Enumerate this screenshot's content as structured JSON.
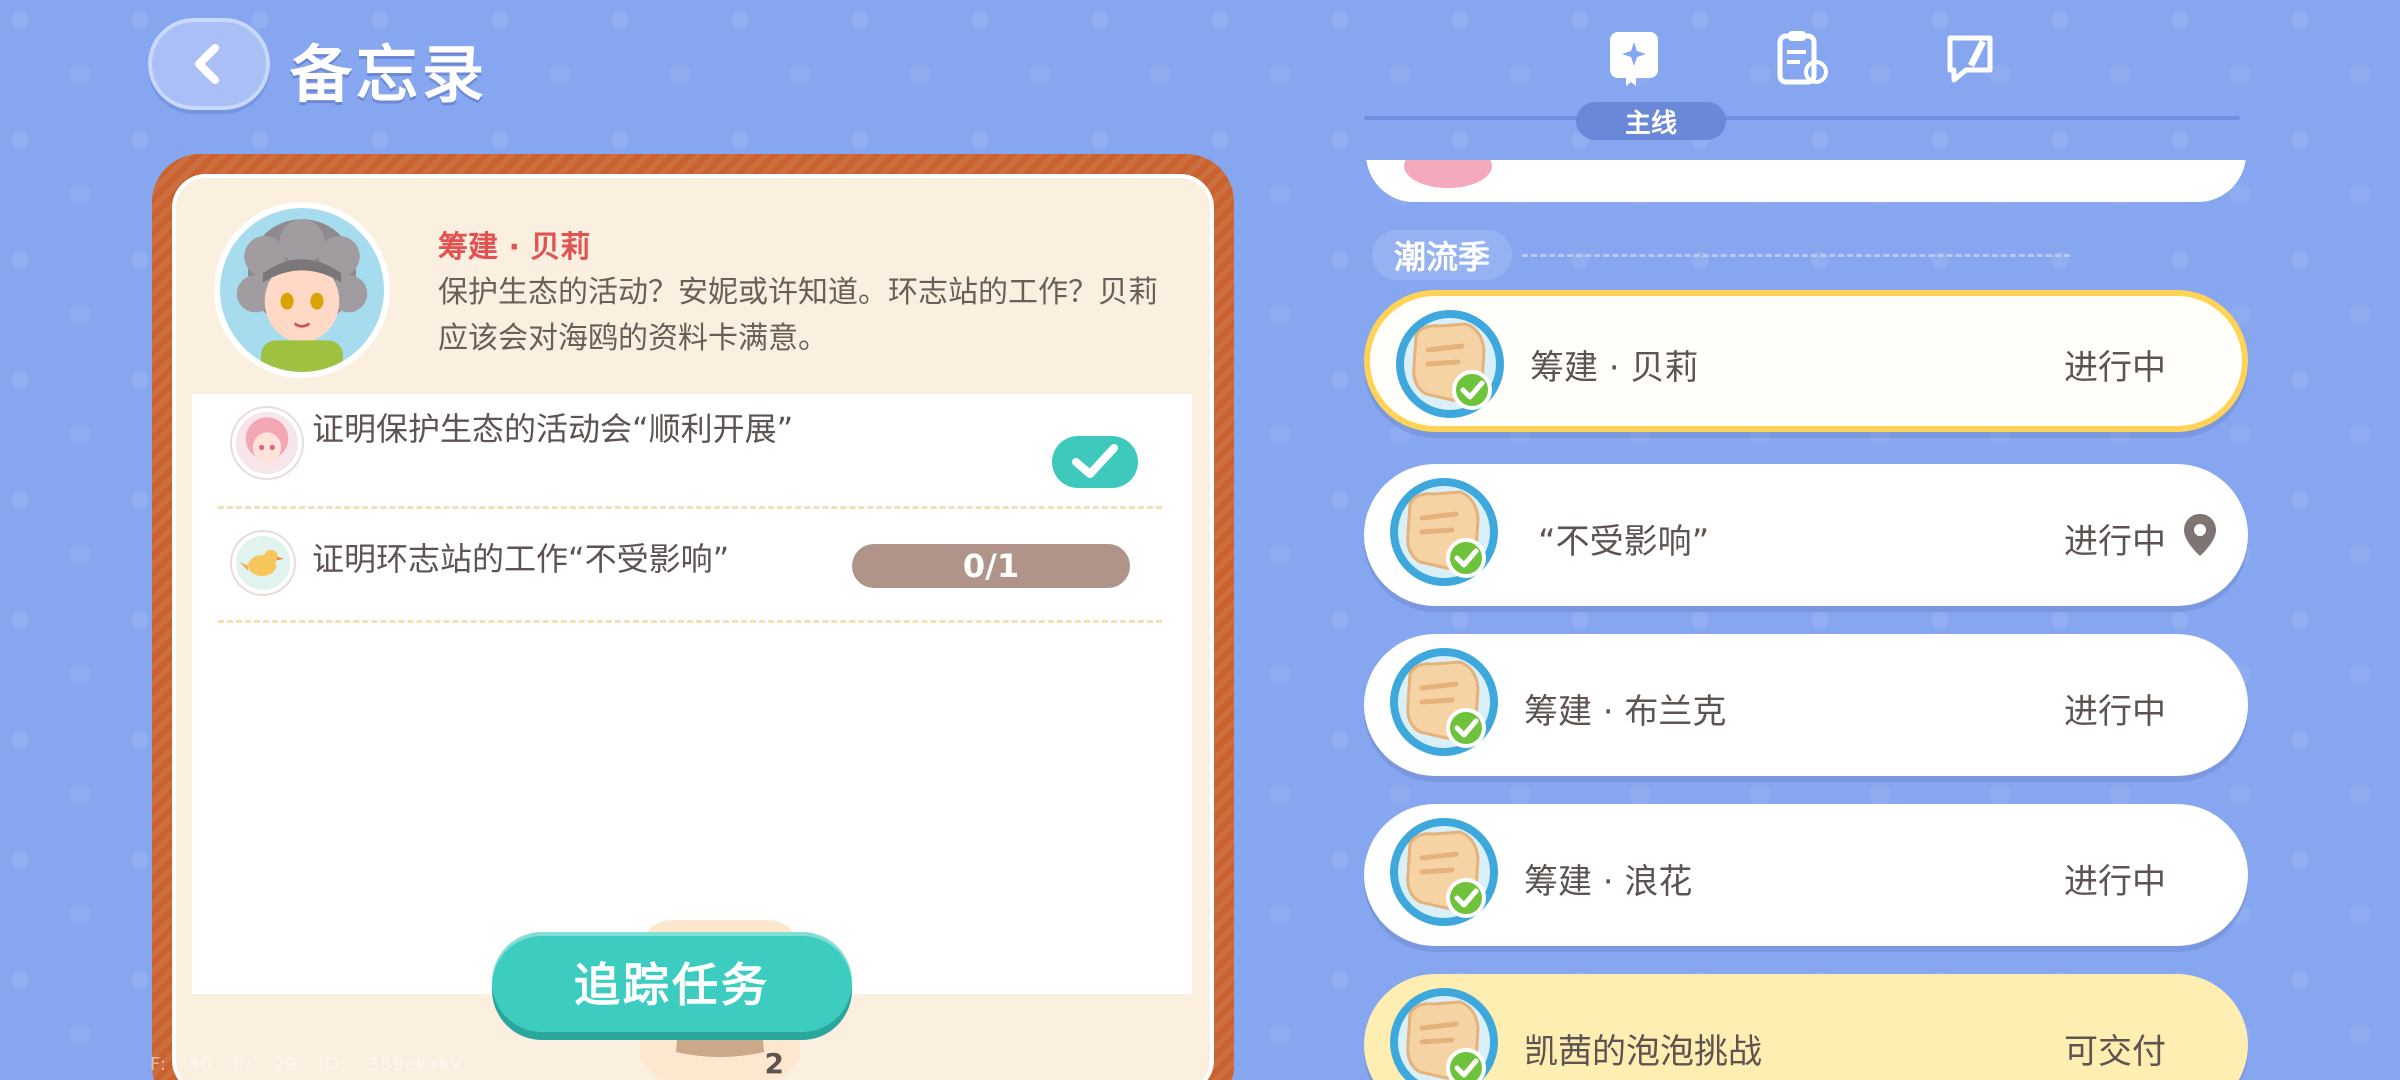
{
  "header": {
    "title": "备忘录"
  },
  "tabs": {
    "active_label": "主线",
    "items": [
      {
        "icon": "storybook-star-icon"
      },
      {
        "icon": "clipboard-refresh-icon"
      },
      {
        "icon": "speech-pen-icon"
      }
    ]
  },
  "detail": {
    "npc_name": "筹建 · 贝莉",
    "description": "保护生态的活动？安妮或许知道。环志站的工作？贝莉应该会对海鸥的资料卡满意。",
    "tasks": [
      {
        "text": "证明保护生态的活动会“顺利开展”",
        "done": true
      },
      {
        "text": "证明环志站的工作“不受影响”",
        "progress": "0/1"
      }
    ],
    "reward": {
      "icon": "seed-bag-icon",
      "count": "2"
    },
    "track_button": "追踪任务"
  },
  "debug": "F: 30 P: 29 ID: 359ckxkv",
  "quest_list": {
    "section": "潮流季",
    "quests": [
      {
        "name": "筹建 · 贝莉",
        "status": "进行中",
        "selected": true
      },
      {
        "name": "“不受影响”",
        "status": "进行中",
        "pinned": true
      },
      {
        "name": "筹建 · 布兰克",
        "status": "进行中"
      },
      {
        "name": "筹建 · 浪花",
        "status": "进行中"
      },
      {
        "name": "凯茜的泡泡挑战",
        "status": "可交付",
        "ready": true
      }
    ]
  },
  "colors": {
    "background": "#86a6f0",
    "accent_teal": "#3dccc0",
    "npc_name": "#e25252",
    "selected_border": "#ffd456",
    "card_frame": "#c9622e"
  }
}
